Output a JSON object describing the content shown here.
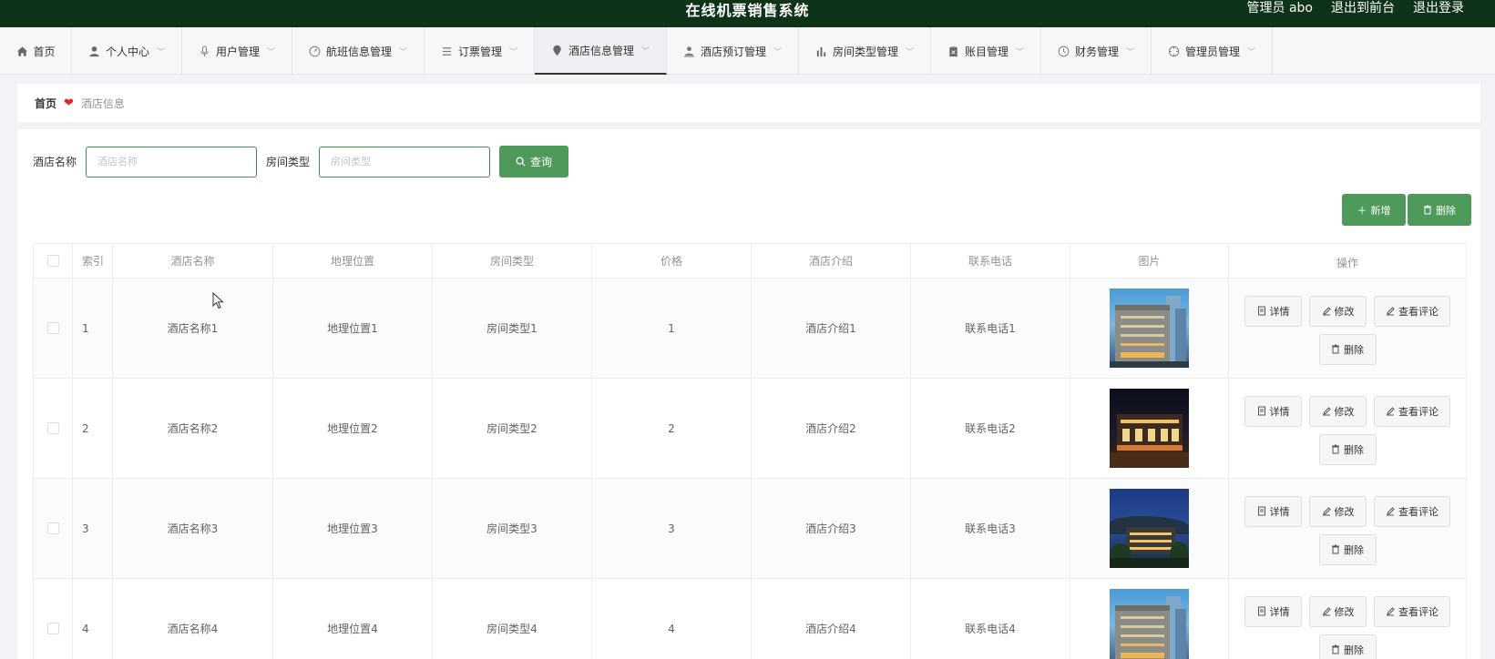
{
  "header": {
    "title": "在线机票销售系统",
    "user": "管理员 abo",
    "back_front": "退出到前台",
    "logout": "退出登录"
  },
  "nav": [
    {
      "label": "首页",
      "icon": "home-icon",
      "chevron": false
    },
    {
      "label": "个人中心",
      "icon": "person-icon",
      "chevron": true
    },
    {
      "label": "用户管理",
      "icon": "microphone-icon",
      "chevron": true
    },
    {
      "label": "航班信息管理",
      "icon": "gauge-icon",
      "chevron": true
    },
    {
      "label": "订票管理",
      "icon": "list-icon",
      "chevron": true
    },
    {
      "label": "酒店信息管理",
      "icon": "location-pin-icon",
      "chevron": true,
      "active": true
    },
    {
      "label": "酒店预订管理",
      "icon": "person-badge-icon",
      "chevron": true
    },
    {
      "label": "房间类型管理",
      "icon": "bar-chart-icon",
      "chevron": true
    },
    {
      "label": "账目管理",
      "icon": "clipboard-icon",
      "chevron": true
    },
    {
      "label": "财务管理",
      "icon": "clock-icon",
      "chevron": true
    },
    {
      "label": "管理员管理",
      "icon": "crosshair-icon",
      "chevron": true
    }
  ],
  "breadcrumb": {
    "home": "首页",
    "current": "酒店信息"
  },
  "search": {
    "name_label": "酒店名称",
    "name_placeholder": "酒店名称",
    "type_label": "房间类型",
    "type_placeholder": "房间类型",
    "query_label": "查询"
  },
  "toolbar": {
    "add_label": "新增",
    "delete_label": "删除"
  },
  "table": {
    "headers": {
      "index": "索引",
      "name": "酒店名称",
      "location": "地理位置",
      "room_type": "房间类型",
      "price": "价格",
      "intro": "酒店介绍",
      "phone": "联系电话",
      "image": "图片",
      "ops": "操作"
    },
    "ops": {
      "detail": "详情",
      "edit": "修改",
      "reviews": "查看评论",
      "delete": "删除"
    },
    "rows": [
      {
        "index": "1",
        "name": "酒店名称1",
        "location": "地理位置1",
        "room_type": "房间类型1",
        "price": "1",
        "intro": "酒店介绍1",
        "phone": "联系电话1",
        "image": "day"
      },
      {
        "index": "2",
        "name": "酒店名称2",
        "location": "地理位置2",
        "room_type": "房间类型2",
        "price": "2",
        "intro": "酒店介绍2",
        "phone": "联系电话2",
        "image": "night"
      },
      {
        "index": "3",
        "name": "酒店名称3",
        "location": "地理位置3",
        "room_type": "房间类型3",
        "price": "3",
        "intro": "酒店介绍3",
        "phone": "联系电话3",
        "image": "dusk"
      },
      {
        "index": "4",
        "name": "酒店名称4",
        "location": "地理位置4",
        "room_type": "房间类型4",
        "price": "4",
        "intro": "酒店介绍4",
        "phone": "联系电话4",
        "image": "day"
      }
    ]
  },
  "colors": {
    "topbar": "#0f3318",
    "accent": "#4e9a5a",
    "heart": "#e4262b"
  }
}
